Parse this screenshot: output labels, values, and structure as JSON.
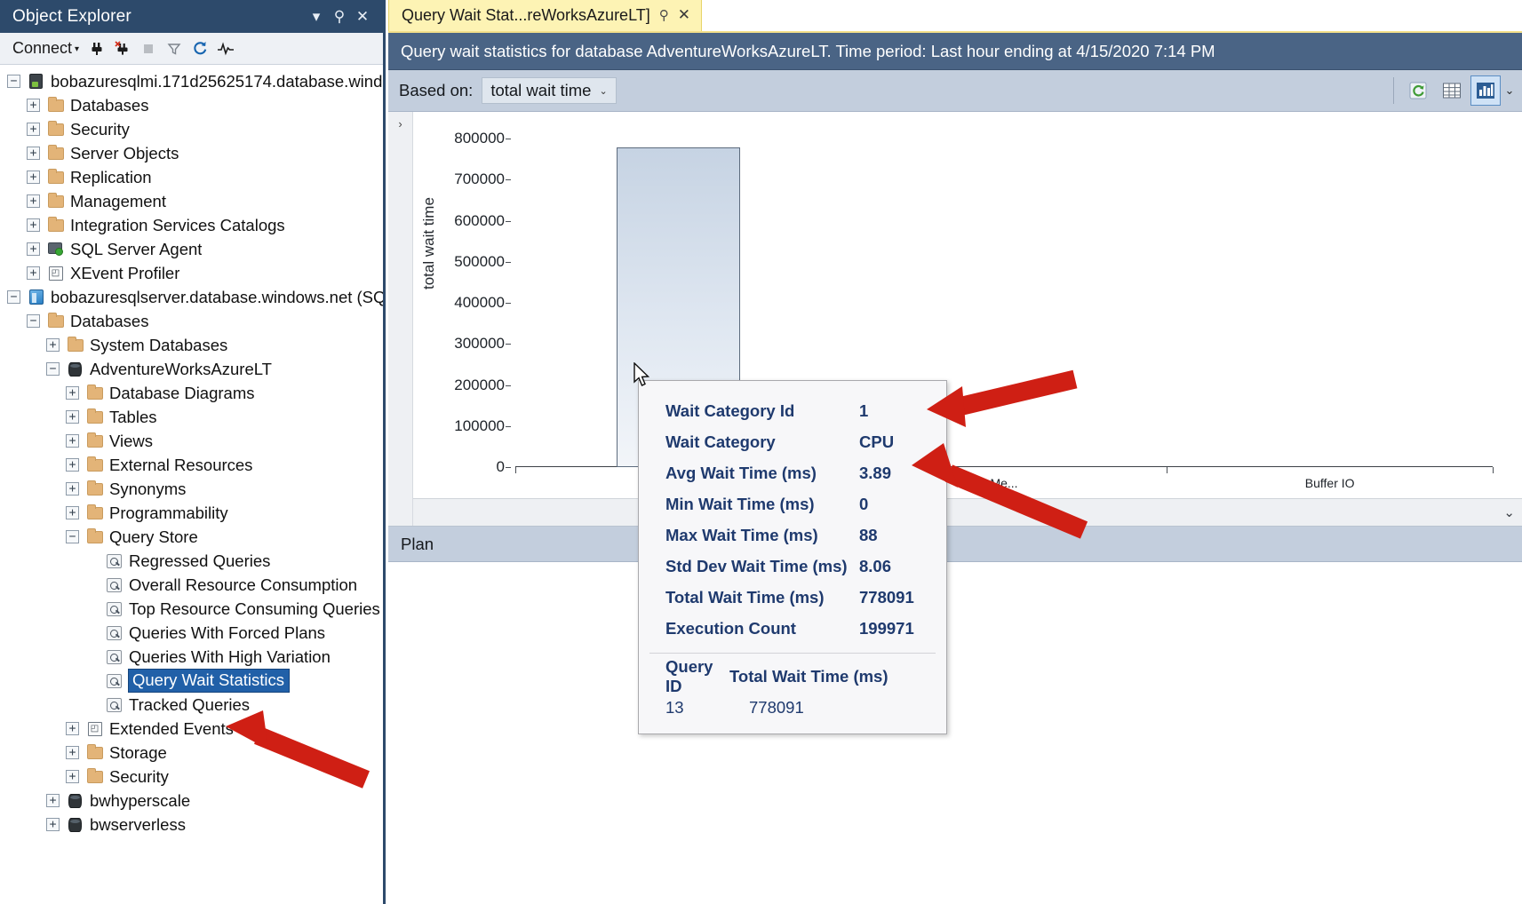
{
  "object_explorer": {
    "title": "Object Explorer",
    "window_buttons": {
      "dropdown": "▾",
      "pin": "⚲",
      "close": "✕"
    },
    "toolbar": {
      "connect_label": "Connect",
      "connect_caret": "▾",
      "icons": [
        "connect-icon",
        "disconnect-icon",
        "stop-icon",
        "filter-icon",
        "refresh-icon",
        "activity-monitor-icon"
      ]
    },
    "tree": [
      {
        "label": "bobazuresqlmi.171d25625174.database.wind",
        "depth": 0,
        "expander": "−",
        "icon": "server-icon"
      },
      {
        "label": "Databases",
        "depth": 1,
        "expander": "+",
        "icon": "folder-icon"
      },
      {
        "label": "Security",
        "depth": 1,
        "expander": "+",
        "icon": "folder-icon"
      },
      {
        "label": "Server Objects",
        "depth": 1,
        "expander": "+",
        "icon": "folder-icon"
      },
      {
        "label": "Replication",
        "depth": 1,
        "expander": "+",
        "icon": "folder-icon"
      },
      {
        "label": "Management",
        "depth": 1,
        "expander": "+",
        "icon": "folder-icon"
      },
      {
        "label": "Integration Services Catalogs",
        "depth": 1,
        "expander": "+",
        "icon": "folder-icon"
      },
      {
        "label": "SQL Server Agent",
        "depth": 1,
        "expander": "+",
        "icon": "agent-icon"
      },
      {
        "label": "XEvent Profiler",
        "depth": 1,
        "expander": "+",
        "icon": "xevent-icon"
      },
      {
        "label": "bobazuresqlserver.database.windows.net (SQ",
        "depth": 0,
        "expander": "−",
        "icon": "azure-server-icon"
      },
      {
        "label": "Databases",
        "depth": 1,
        "expander": "−",
        "icon": "folder-icon"
      },
      {
        "label": "System Databases",
        "depth": 2,
        "expander": "+",
        "icon": "folder-icon"
      },
      {
        "label": "AdventureWorksAzureLT",
        "depth": 2,
        "expander": "−",
        "icon": "database-icon"
      },
      {
        "label": "Database Diagrams",
        "depth": 3,
        "expander": "+",
        "icon": "folder-icon"
      },
      {
        "label": "Tables",
        "depth": 3,
        "expander": "+",
        "icon": "folder-icon"
      },
      {
        "label": "Views",
        "depth": 3,
        "expander": "+",
        "icon": "folder-icon"
      },
      {
        "label": "External Resources",
        "depth": 3,
        "expander": "+",
        "icon": "folder-icon"
      },
      {
        "label": "Synonyms",
        "depth": 3,
        "expander": "+",
        "icon": "folder-icon"
      },
      {
        "label": "Programmability",
        "depth": 3,
        "expander": "+",
        "icon": "folder-icon"
      },
      {
        "label": "Query Store",
        "depth": 3,
        "expander": "−",
        "icon": "folder-icon"
      },
      {
        "label": "Regressed Queries",
        "depth": 4,
        "expander": "",
        "icon": "report-icon"
      },
      {
        "label": "Overall Resource Consumption",
        "depth": 4,
        "expander": "",
        "icon": "report-icon"
      },
      {
        "label": "Top Resource Consuming Queries",
        "depth": 4,
        "expander": "",
        "icon": "report-icon"
      },
      {
        "label": "Queries With Forced Plans",
        "depth": 4,
        "expander": "",
        "icon": "report-icon"
      },
      {
        "label": "Queries With High Variation",
        "depth": 4,
        "expander": "",
        "icon": "report-icon"
      },
      {
        "label": "Query Wait Statistics",
        "depth": 4,
        "expander": "",
        "icon": "report-icon",
        "selected": true
      },
      {
        "label": "Tracked Queries",
        "depth": 4,
        "expander": "",
        "icon": "report-icon"
      },
      {
        "label": "Extended Events",
        "depth": 3,
        "expander": "+",
        "icon": "xevent-icon"
      },
      {
        "label": "Storage",
        "depth": 3,
        "expander": "+",
        "icon": "folder-icon"
      },
      {
        "label": "Security",
        "depth": 3,
        "expander": "+",
        "icon": "folder-icon"
      },
      {
        "label": "bwhyperscale",
        "depth": 2,
        "expander": "+",
        "icon": "database-icon"
      },
      {
        "label": "bwserverless",
        "depth": 2,
        "expander": "+",
        "icon": "database-icon"
      }
    ]
  },
  "document": {
    "tab": {
      "label": "Query Wait Stat...reWorksAzureLT]",
      "pin": "⚲",
      "close": "✕"
    },
    "banner": "Query wait statistics for database AdventureWorksAzureLT. Time period: Last hour ending at 4/15/2020 7:14 PM",
    "toolbar": {
      "based_on_label": "Based on:",
      "based_on_value": "total wait time",
      "based_on_caret": "⌄",
      "buttons": [
        {
          "name": "refresh-icon",
          "glyph": "⟳",
          "active": false
        },
        {
          "name": "grid-view-icon",
          "glyph": "▦",
          "active": false
        },
        {
          "name": "chart-view-icon",
          "glyph": "▮▮",
          "active": true
        }
      ],
      "overflow": "⌄"
    },
    "chart_gutter_glyph": "›",
    "chart_scroll_chevron": "⌄",
    "plan_header": "Plan"
  },
  "chart_data": {
    "type": "bar",
    "title": "",
    "xlabel": "",
    "ylabel": "total wait time",
    "categories": [
      "CPU",
      "Memory",
      "Buffer IO"
    ],
    "category_display": [
      "CPU",
      "Me...",
      "Buffer IO"
    ],
    "values": [
      778091,
      0,
      0
    ],
    "ylim": [
      0,
      800000
    ],
    "yticks": [
      0,
      100000,
      200000,
      300000,
      400000,
      500000,
      600000,
      700000,
      800000
    ],
    "ytick_labels": [
      "0",
      "100000",
      "200000",
      "300000",
      "400000",
      "500000",
      "600000",
      "700000",
      "800000"
    ],
    "grid": false,
    "legend": false
  },
  "tooltip": {
    "rows": [
      {
        "key": "Wait Category Id",
        "value": "1"
      },
      {
        "key": "Wait Category",
        "value": "CPU"
      },
      {
        "key": "Avg Wait Time (ms)",
        "value": "3.89"
      },
      {
        "key": "Min Wait Time (ms)",
        "value": "0"
      },
      {
        "key": "Max Wait Time (ms)",
        "value": "88"
      },
      {
        "key": "Std Dev Wait Time (ms)",
        "value": "8.06"
      },
      {
        "key": "Total Wait Time (ms)",
        "value": "778091"
      },
      {
        "key": "Execution Count",
        "value": "199971"
      }
    ],
    "table": {
      "headers": [
        "Query ID",
        "Total Wait Time (ms)"
      ],
      "rows": [
        [
          "13",
          "778091"
        ]
      ]
    }
  },
  "annotations": {
    "arrow_color": "#e0261c",
    "arrows": [
      "arrow-to-wait-category",
      "arrow-to-avg-wait-time",
      "arrow-to-query-wait-statistics"
    ]
  }
}
